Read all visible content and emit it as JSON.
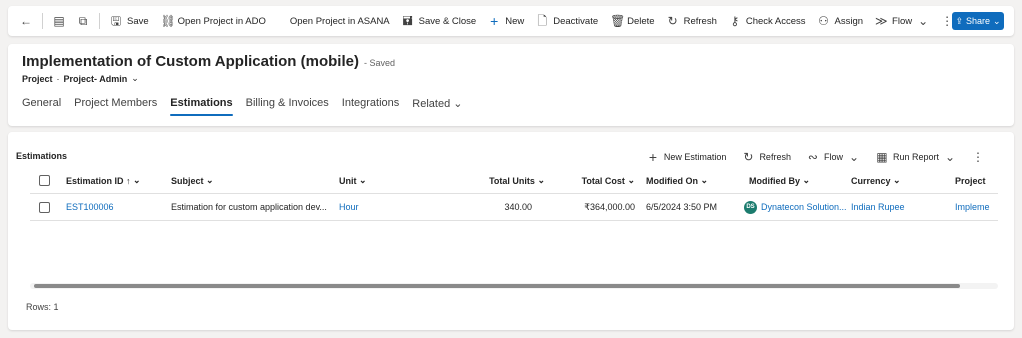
{
  "commandbar": {
    "items": [
      {
        "label": "Save",
        "icon": "save-icon",
        "glyph": "🖫"
      },
      {
        "label": "Open Project in ADO",
        "icon": "link-icon",
        "glyph": "⛓"
      },
      {
        "label": "Open Project in ASANA",
        "icon": "none",
        "glyph": ""
      },
      {
        "label": "Save & Close",
        "icon": "save-close-icon",
        "glyph": "🖬"
      },
      {
        "label": "New",
        "icon": "plus-icon",
        "glyph": "+"
      },
      {
        "label": "Deactivate",
        "icon": "deactivate-icon",
        "glyph": "🗋"
      },
      {
        "label": "Delete",
        "icon": "trash-icon",
        "glyph": "🗑"
      },
      {
        "label": "Refresh",
        "icon": "refresh-icon",
        "glyph": "↻"
      },
      {
        "label": "Check Access",
        "icon": "key-icon",
        "glyph": "⚷"
      },
      {
        "label": "Assign",
        "icon": "person-icon",
        "glyph": "⚇"
      },
      {
        "label": "Flow",
        "icon": "flow-icon",
        "glyph": "≫"
      }
    ],
    "share_label": "Share"
  },
  "record": {
    "title": "Implementation of Custom Application (mobile)",
    "status": "- Saved",
    "entity": "Project",
    "form": "Project- Admin"
  },
  "tabs": [
    "General",
    "Project Members",
    "Estimations",
    "Billing & Invoices",
    "Integrations",
    "Related"
  ],
  "active_tab": "Estimations",
  "grid": {
    "title": "Estimations",
    "tools": {
      "new": "New Estimation",
      "refresh": "Refresh",
      "flow": "Flow",
      "report": "Run Report"
    },
    "columns": [
      "Estimation ID",
      "Subject",
      "Unit",
      "Total Units",
      "Total Cost",
      "Modified On",
      "Modified By",
      "Currency",
      "Project"
    ],
    "sort_indicator": "↑",
    "rows": [
      {
        "id": "EST100006",
        "subject": "Estimation for custom application dev...",
        "unit": "Hour",
        "total_units": "340.00",
        "total_cost": "₹364,000.00",
        "modified_on": "6/5/2024 3:50 PM",
        "modified_by": "Dynatecon Solution...",
        "avatar": "DS",
        "currency": "Indian Rupee",
        "project": "Impleme"
      }
    ],
    "footer": "Rows: 1"
  },
  "colors": {
    "accent": "#0f6cbd",
    "avatar": "#1c7c6e"
  }
}
